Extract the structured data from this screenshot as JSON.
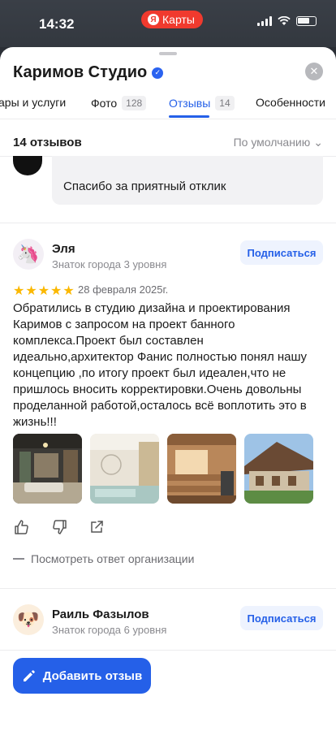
{
  "status": {
    "time": "14:32",
    "app_pill": "Карты",
    "ya_letter": "Я"
  },
  "header": {
    "title": "Каримов Студио",
    "close_label": "✕"
  },
  "tabs": [
    {
      "label": "ары и услуги"
    },
    {
      "label": "Фото",
      "count": "128"
    },
    {
      "label": "Отзывы",
      "count": "14"
    },
    {
      "label": "Особенности"
    }
  ],
  "summary": {
    "count_text": "14 отзывов",
    "sort_label": "По умолчанию"
  },
  "previous_reply": {
    "text": "Спасибо за приятный отклик"
  },
  "reviews": [
    {
      "name": "Эля",
      "level": "Знаток города 3 уровня",
      "subscribe_label": "Подписаться",
      "rating": 5,
      "date": "28 февраля 2025г.",
      "text": "Обратились в студию дизайна и проектирования Каримов с запросом на проект банного комплекса.Проект был составлен идеально,архитектор Фанис полностью понял нашу концепцию ,по итогу проект был идеален,что не пришлось вносить корректировки.Очень довольны проделанной работой,осталось всё воплотить это в жизнь!!!",
      "see_reply_label": "Посмотреть ответ организации"
    },
    {
      "name": "Раиль Фазылов",
      "level": "Знаток города 6 уровня",
      "subscribe_label": "Подписаться"
    }
  ],
  "add_review": {
    "label": "Добавить отзыв"
  },
  "colors": {
    "accent": "#2560e8",
    "star": "#fbb800",
    "pill": "#f03a2e"
  }
}
